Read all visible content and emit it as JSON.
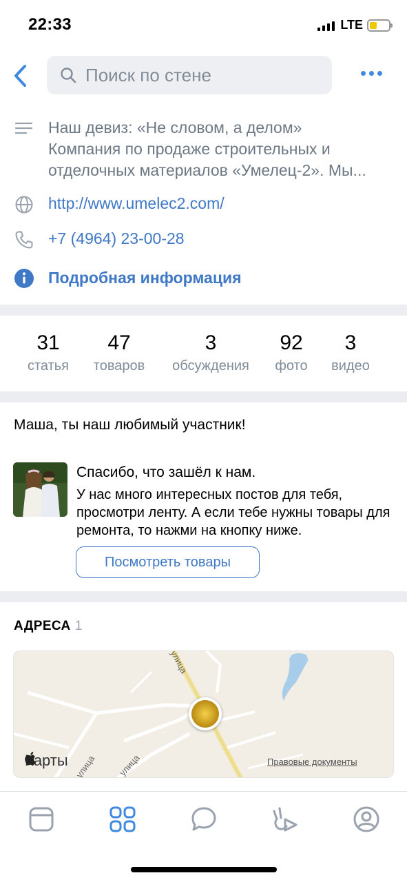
{
  "status_bar": {
    "time": "22:33",
    "network": "LTE"
  },
  "header": {
    "search_placeholder": "Поиск по стене"
  },
  "info": {
    "description": [
      "Наш девиз: «Не словом, а делом»",
      "Компания по продаже строительных и",
      "отделочных материалов «Умелец-2».  Мы..."
    ],
    "website": "http://www.umelec2.com/",
    "phone": "+7 (4964) 23-00-28",
    "more_info": "Подробная информация"
  },
  "counters": [
    {
      "value": "31",
      "label": "статья"
    },
    {
      "value": "47",
      "label": "товаров"
    },
    {
      "value": "3",
      "label": "обсуждения"
    },
    {
      "value": "92",
      "label": "фото"
    },
    {
      "value": "3",
      "label": "видео"
    }
  ],
  "greeting": {
    "title": "Маша, ты наш любимый участник!",
    "headline": "Спасибо, что зашёл к нам.",
    "body": "У нас много интересных постов для тебя, просмотри ленту. А если тебе нужны товары для ремонта, то нажми на кнопку ниже.",
    "button_label": "Посмотреть товары"
  },
  "addresses": {
    "title": "АДРЕСА",
    "count": "1",
    "map_brand": "Карты",
    "map_legal": "Правовые документы",
    "street_labels": [
      "улица",
      "улица",
      "улица"
    ]
  },
  "tabbar": {
    "tabs": [
      {
        "icon": "newsfeed-icon",
        "active": false
      },
      {
        "icon": "services-icon",
        "active": true
      },
      {
        "icon": "messages-icon",
        "active": false
      },
      {
        "icon": "clips-icon",
        "active": false
      },
      {
        "icon": "profile-icon",
        "active": false
      }
    ]
  },
  "colors": {
    "accent": "#3f78c6",
    "secondary_text": "#818c99",
    "separator": "#ebedf0"
  }
}
